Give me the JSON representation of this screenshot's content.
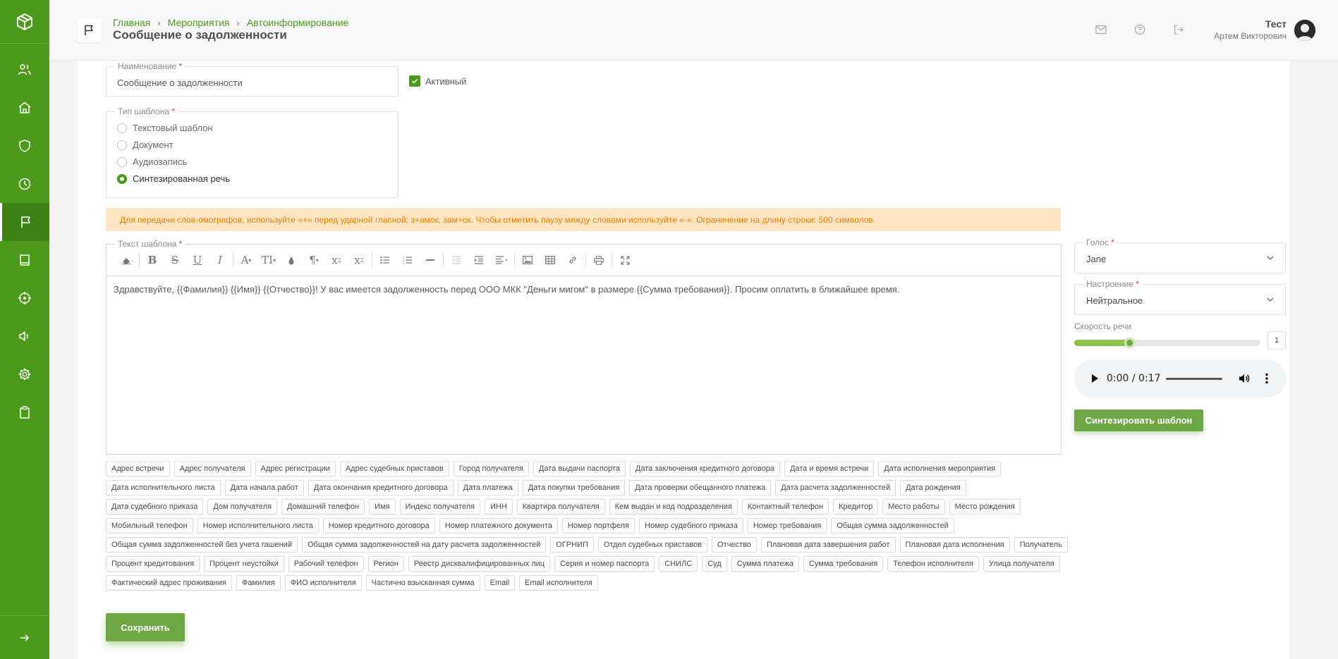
{
  "app": {
    "accent": "#4c9a19",
    "sidebar_items": [
      {
        "icon": "users-icon",
        "active": false
      },
      {
        "icon": "home-icon",
        "active": false
      },
      {
        "icon": "shield-icon",
        "active": false
      },
      {
        "icon": "clock-icon",
        "active": false
      },
      {
        "icon": "flag-icon",
        "active": true
      },
      {
        "icon": "book-icon",
        "active": false
      },
      {
        "icon": "target-icon",
        "active": false
      },
      {
        "icon": "speaker-icon",
        "active": false
      },
      {
        "icon": "gear-icon",
        "active": false
      },
      {
        "icon": "clipboard-icon",
        "active": false
      }
    ]
  },
  "header": {
    "breadcrumb": [
      "Главная",
      "Мероприятия",
      "Автоинформирование"
    ],
    "title": "Сообщение о задолженности",
    "user_name": "Тест",
    "user_full": "Артем Викторович"
  },
  "form": {
    "name_label": "Наименование",
    "name_value": "Сообщение о задолженности",
    "active_label": "Активный",
    "active_checked": true,
    "template_type_label": "Тип шаблона",
    "template_types": [
      {
        "label": "Текстовый шаблон",
        "checked": false
      },
      {
        "label": "Документ",
        "checked": false
      },
      {
        "label": "Аудиозапись",
        "checked": false
      },
      {
        "label": "Синтезированная речь",
        "checked": true
      }
    ],
    "alert": "Для передачи слов-омографов, используйте «+» перед ударной гласной: з+амок, зам+ок. Чтобы отметить паузу между словами используйте «-». Ограничение на длину строки: 500 символов.",
    "text_label": "Текст шаблона",
    "text_value": "Здравствуйте, {{Фамилия}} {{Имя}} {{Отчество}}! У вас имеется задолженность перед ООО МКК \"Деньги мигом\" в размере {{Сумма требования}}. Просим оплатить в ближайшее время.",
    "toolbar": [
      "eraser-icon",
      "bold-icon",
      "strikethrough-icon",
      "underline-icon",
      "italic-icon",
      "font-color-icon",
      "font-size-icon",
      "brush-icon",
      "paragraph-icon",
      "superscript-icon",
      "subscript-icon",
      "bullet-list-icon",
      "numbered-list-icon",
      "horizontal-rule-icon",
      "outdent-icon",
      "indent-icon",
      "align-icon",
      "image-icon",
      "table-icon",
      "link-icon",
      "print-icon",
      "fullscreen-icon"
    ],
    "variables": [
      "Адрес встречи",
      "Адрес получателя",
      "Адрес регистрации",
      "Адрес судебных приставов",
      "Город получателя",
      "Дата выдачи паспорта",
      "Дата заключения кредитного договора",
      "Дата и время встречи",
      "Дата исполнения мероприятия",
      "Дата исполнительного листа",
      "Дата начала работ",
      "Дата окончания кредитного договора",
      "Дата платежа",
      "Дата покупки требования",
      "Дата проверки обещанного платежа",
      "Дата расчета задолженностей",
      "Дата рождения",
      "Дата судебного приказа",
      "Дом получателя",
      "Домашний телефон",
      "Имя",
      "Индекс получателя",
      "ИНН",
      "Квартира получателя",
      "Кем выдан и код подразделения",
      "Контактный телефон",
      "Кредитор",
      "Место работы",
      "Место рождения",
      "Мобильный телефон",
      "Номер исполнительного листа",
      "Номер кредитного договора",
      "Номер платежного документа",
      "Номер портфеля",
      "Номер судебного приказа",
      "Номер требования",
      "Общая сумма задолженностей",
      "Общая сумма задолженностей без учета гашений",
      "Общая сумма задолженностей на дату расчета задолженностей",
      "ОГРНИП",
      "Отдел судебных приставов",
      "Отчество",
      "Плановая дата завершения работ",
      "Плановая дата исполнения",
      "Получатель",
      "Процент кредитования",
      "Процент неустойки",
      "Рабочий телефон",
      "Регион",
      "Реестр дисквалифицированных лиц",
      "Серия и номер паспорта",
      "СНИЛС",
      "Суд",
      "Сумма платежа",
      "Сумма требования",
      "Телефон исполнителя",
      "Улица получателя",
      "Фактический адрес проживания",
      "Фамилия",
      "ФИО исполнителя",
      "Частично взысканная сумма",
      "Email",
      "Email исполнителя"
    ],
    "save_label": "Сохранить"
  },
  "synth": {
    "voice_label": "Голос",
    "voice_value": "Jane",
    "mood_label": "Настроение",
    "mood_value": "Нейтральное",
    "speed_label": "Скорость речи",
    "speed_value": "1",
    "speed_fraction": 0.3,
    "audio_time": "0:00 / 0:17",
    "synth_label": "Синтезировать шаблон"
  }
}
